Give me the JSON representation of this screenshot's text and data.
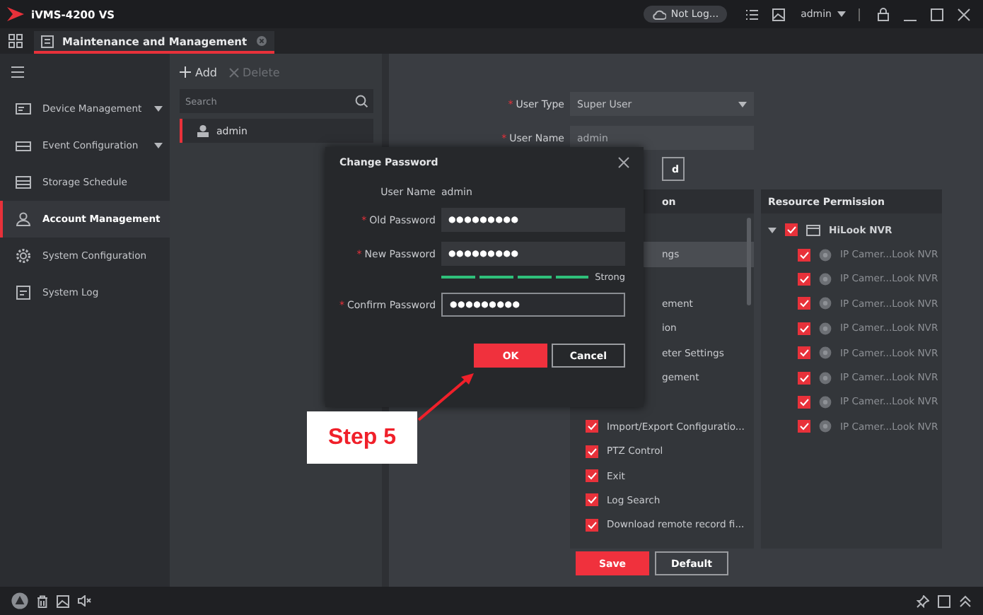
{
  "app": {
    "title": "iVMS-4200 VS",
    "cloud_status": "Not Log...",
    "user": "admin"
  },
  "tabs": [
    {
      "label": "Maintenance and Management",
      "selected": true
    }
  ],
  "sidebar": {
    "items": [
      {
        "label": "Device Management",
        "expandable": true,
        "selected": false
      },
      {
        "label": "Event Configuration",
        "expandable": true,
        "selected": false
      },
      {
        "label": "Storage Schedule",
        "expandable": false,
        "selected": false
      },
      {
        "label": "Account Management",
        "expandable": false,
        "selected": true
      },
      {
        "label": "System Configuration",
        "expandable": false,
        "selected": false
      },
      {
        "label": "System Log",
        "expandable": false,
        "selected": false
      }
    ]
  },
  "users": {
    "actions": [
      {
        "label": "Add",
        "kind": "add",
        "disabled": false
      },
      {
        "label": "Delete",
        "kind": "delete",
        "disabled": true
      }
    ],
    "search": {
      "placeholder": "Search"
    },
    "items": [
      {
        "name": "admin",
        "selected": true
      }
    ]
  },
  "user_form": {
    "fields": [
      {
        "mark": "*",
        "label": "User Type",
        "kind": "select",
        "value": "Super User"
      },
      {
        "mark": "*",
        "label": "User Name",
        "kind": "text",
        "value": "admin"
      }
    ],
    "button_fragment": "d"
  },
  "permissions": {
    "header": "on",
    "items": [
      {
        "kind": "covered",
        "label": "ngs",
        "selected": true
      },
      {
        "kind": "covered",
        "label": "ement",
        "selected": false
      },
      {
        "kind": "covered",
        "label": "ion",
        "selected": false
      },
      {
        "kind": "covered",
        "label": "eter Settings",
        "selected": false
      },
      {
        "kind": "covered",
        "label": "gement",
        "selected": false
      },
      {
        "kind": "check",
        "label": "Import/Export Configuratio...",
        "checked": true,
        "selected": false
      },
      {
        "kind": "check",
        "label": "PTZ Control",
        "checked": true,
        "selected": false
      },
      {
        "kind": "check",
        "label": "Exit",
        "checked": true,
        "selected": false
      },
      {
        "kind": "check",
        "label": "Log Search",
        "checked": true,
        "selected": false
      },
      {
        "kind": "check",
        "label": "Download remote record fi...",
        "checked": true,
        "selected": false
      }
    ]
  },
  "resources": {
    "header": "Resource Permission",
    "items": [
      {
        "label": "HiLook NVR",
        "checked": true,
        "expanded": true,
        "children": [
          {
            "label": "IP Camer...Look NVR",
            "checked": true
          },
          {
            "label": "IP Camer...Look NVR",
            "checked": true
          },
          {
            "label": "IP Camer...Look NVR",
            "checked": true
          },
          {
            "label": "IP Camer...Look NVR",
            "checked": true
          },
          {
            "label": "IP Camer...Look NVR",
            "checked": true
          },
          {
            "label": "IP Camer...Look NVR",
            "checked": true
          },
          {
            "label": "IP Camer...Look NVR",
            "checked": true
          },
          {
            "label": "IP Camer...Look NVR",
            "checked": true
          }
        ]
      }
    ]
  },
  "buttons": [
    {
      "label": "Save",
      "kind": "primary"
    },
    {
      "label": "Default",
      "kind": "secondary"
    }
  ],
  "dialog": {
    "title": "Change Password",
    "user_name_label": "User Name",
    "user_name": "admin",
    "fields": [
      {
        "mark": "*",
        "label": "Old Password",
        "value": "●●●●●●●●●",
        "focused": false
      },
      {
        "mark": "*",
        "label": "New Password",
        "value": "●●●●●●●●●",
        "focused": false
      },
      {
        "mark": "*",
        "label": "Confirm Password",
        "value": "●●●●●●●●●",
        "focused": true
      }
    ],
    "strength": {
      "level": 1,
      "label": "Strong"
    },
    "buttons": [
      {
        "label": "OK",
        "kind": "primary"
      },
      {
        "label": "Cancel",
        "kind": "secondary"
      }
    ]
  },
  "annotation": {
    "text": "Step 5"
  }
}
